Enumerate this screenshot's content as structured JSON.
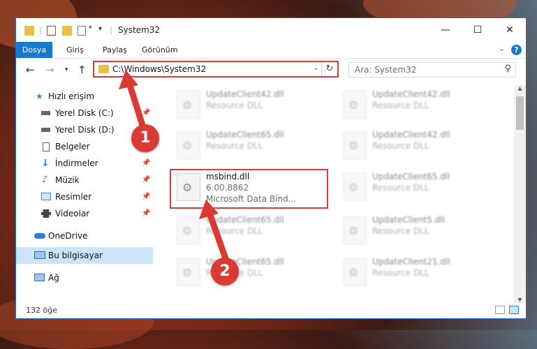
{
  "window": {
    "title": "System32"
  },
  "ribbon": {
    "tabs": [
      "Dosya",
      "Giriş",
      "Paylaş",
      "Görünüm"
    ],
    "help": "?"
  },
  "nav": {
    "address": "C:\\Windows\\System32",
    "search_placeholder": "Ara: System32"
  },
  "sidebar": {
    "items": [
      {
        "label": "Hızlı erişim",
        "icon": "star-icon"
      },
      {
        "label": "Yerel Disk (C:)",
        "icon": "drive-icon"
      },
      {
        "label": "Yerel Disk (D:)",
        "icon": "drive-icon"
      },
      {
        "label": "Belgeler",
        "icon": "documents-icon"
      },
      {
        "label": "İndirmeler",
        "icon": "downloads-icon"
      },
      {
        "label": "Müzik",
        "icon": "music-icon"
      },
      {
        "label": "Resimler",
        "icon": "pictures-icon"
      },
      {
        "label": "Videolar",
        "icon": "videos-icon"
      },
      {
        "label": "OneDrive",
        "icon": "cloud-icon"
      },
      {
        "label": "Bu bilgisayar",
        "icon": "computer-icon"
      },
      {
        "label": "Ağ",
        "icon": "network-icon"
      }
    ]
  },
  "files": [
    {
      "name": "UpdateClient42.dll",
      "type": "Resource DLL"
    },
    {
      "name": "UpdateClient42.dll",
      "type": "Resource DLL"
    },
    {
      "name": "UpdateClient65.dll",
      "type": "Resource DLL"
    },
    {
      "name": "UpdateClient42.dll",
      "type": "Resource DLL"
    },
    {
      "name": "msbind.dll",
      "version": "6.00.8862",
      "desc": "Microsoft Data Bind..."
    },
    {
      "name": "UpdateClient65.dll",
      "type": "Resource DLL"
    },
    {
      "name": "UpdateClient65.dll",
      "type": "Resource DLL"
    },
    {
      "name": "UpdateClient5.dll",
      "type": "Resource DLL"
    },
    {
      "name": "UpdateClient65.dll",
      "type": "Resource DLL"
    },
    {
      "name": "UpdateClient21.dll",
      "type": "Resource DLL"
    }
  ],
  "status": {
    "count": "132 öğe"
  },
  "annotations": {
    "step1": "1",
    "step2": "2"
  },
  "colors": {
    "accent": "#1979ca",
    "highlight": "#e0393d",
    "badge": "#d93a32"
  }
}
